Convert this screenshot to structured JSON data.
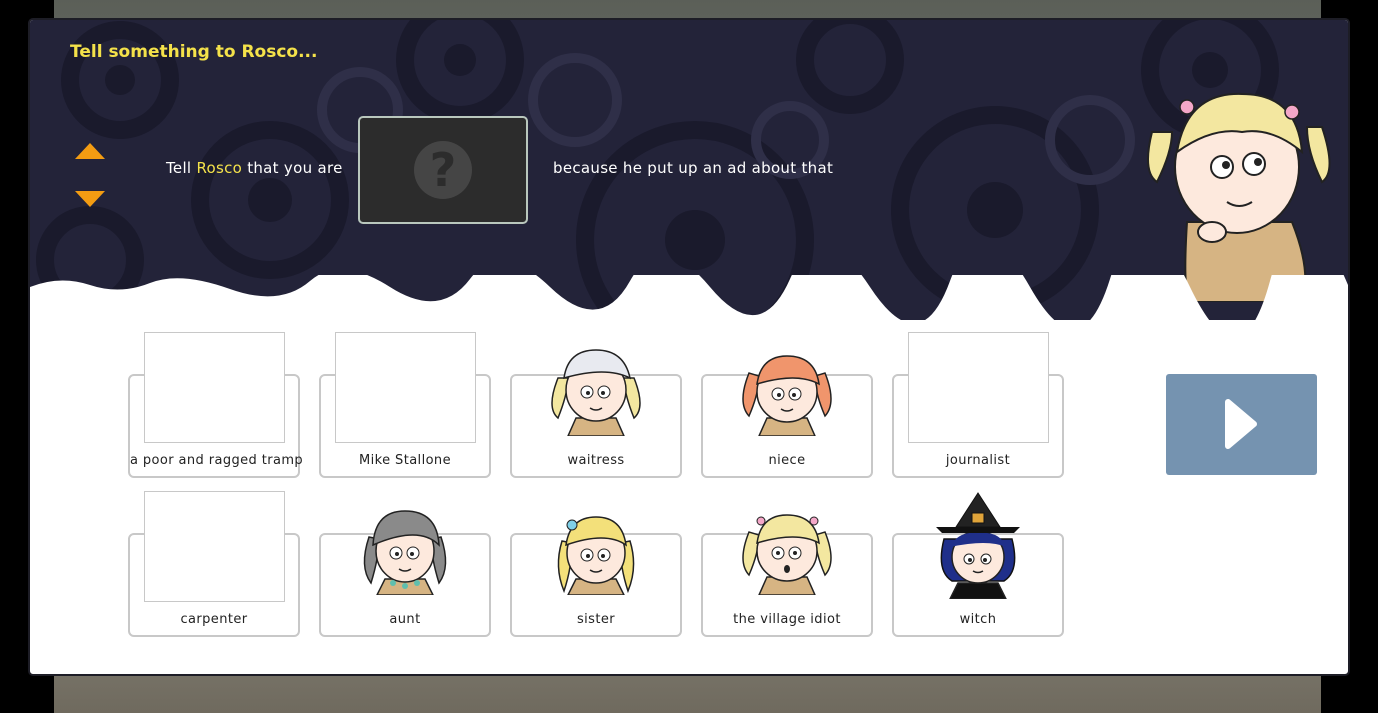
{
  "dialog": {
    "title": "Tell something to Rosco...",
    "sentence": {
      "before_name": "Tell ",
      "name": "Rosco",
      "after_name": " that you are",
      "after_slot": "because he put up an ad about that"
    },
    "slot_icon": "question-mark-icon"
  },
  "choices": [
    {
      "label": "a poor and ragged tramp",
      "picture": "none"
    },
    {
      "label": "Mike Stallone",
      "picture": "none"
    },
    {
      "label": "waitress",
      "picture": "blonde-girl-waitress-cap"
    },
    {
      "label": "niece",
      "picture": "redhead-girl-pigtails"
    },
    {
      "label": "journalist",
      "picture": "none"
    },
    {
      "label": "carpenter",
      "picture": "none"
    },
    {
      "label": "aunt",
      "picture": "grey-haired-woman"
    },
    {
      "label": "sister",
      "picture": "blonde-girl-braids"
    },
    {
      "label": "the village idiot",
      "picture": "blonde-girl-surprised"
    },
    {
      "label": "witch",
      "picture": "blue-haired-witch"
    }
  ],
  "colors": {
    "header_bg": "#232339",
    "title": "#f4e24a",
    "accent_arrows": "#f39c12",
    "next_button": "#7593b0"
  },
  "icons": {
    "up": "arrow-up-icon",
    "down": "arrow-down-icon",
    "next": "play-next-icon"
  }
}
